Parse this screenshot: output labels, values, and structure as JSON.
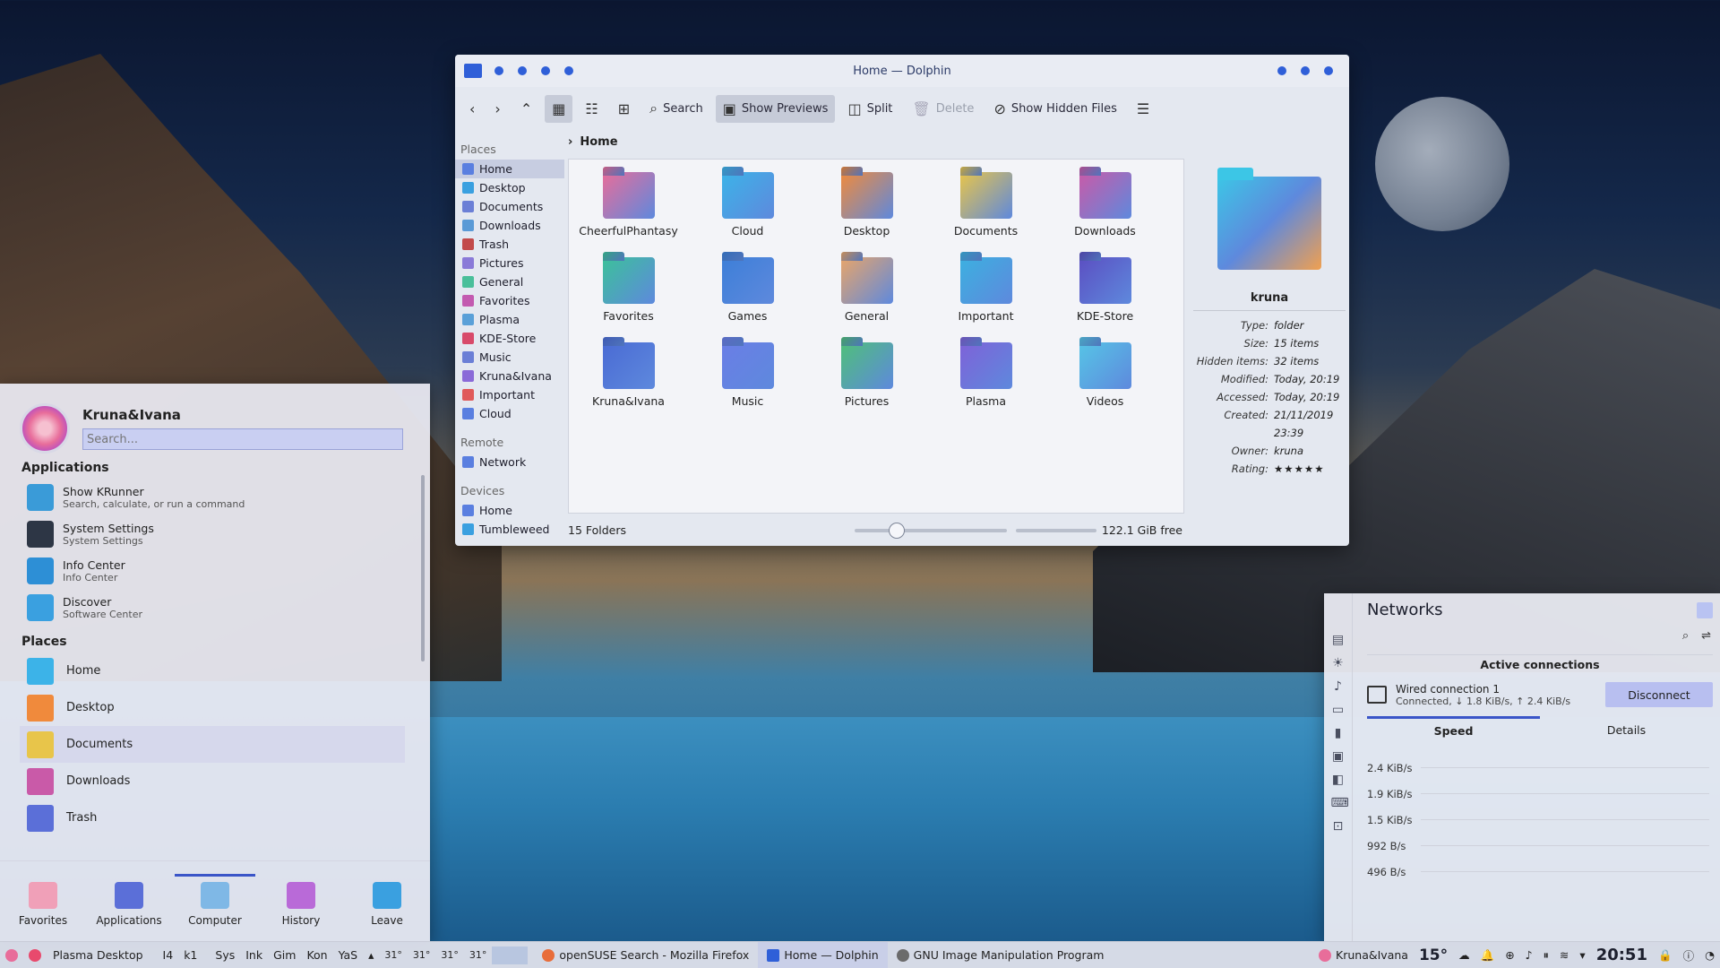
{
  "dolphin": {
    "title": "Home — Dolphin",
    "toolbar": {
      "search": "Search",
      "show_previews": "Show Previews",
      "split": "Split",
      "delete": "Delete",
      "show_hidden": "Show Hidden Files"
    },
    "breadcrumb": "Home",
    "places_header": "Places",
    "places": [
      "Home",
      "Desktop",
      "Documents",
      "Downloads",
      "Trash",
      "Pictures",
      "General",
      "Favorites",
      "Plasma",
      "KDE-Store",
      "Music",
      "Kruna&Ivana",
      "Important",
      "Cloud"
    ],
    "remote_header": "Remote",
    "remote": [
      "Network"
    ],
    "devices_header": "Devices",
    "devices": [
      "Home",
      "Tumbleweed"
    ],
    "folders": [
      {
        "name": "CheerfulPhantasy",
        "color": "#e86d9a"
      },
      {
        "name": "Cloud",
        "color": "#3cb3e8"
      },
      {
        "name": "Desktop",
        "color": "#f08a3c"
      },
      {
        "name": "Documents",
        "color": "#e8c54a"
      },
      {
        "name": "Downloads",
        "color": "#c95aa8"
      },
      {
        "name": "Favorites",
        "color": "#3cc19a"
      },
      {
        "name": "Games",
        "color": "#3d7fd8"
      },
      {
        "name": "General",
        "color": "#e8a56a"
      },
      {
        "name": "Important",
        "color": "#3cb0e0"
      },
      {
        "name": "KDE-Store",
        "color": "#5b4fc2"
      },
      {
        "name": "Kruna&Ivana",
        "color": "#4a6bd4"
      },
      {
        "name": "Music",
        "color": "#6a7ee6"
      },
      {
        "name": "Pictures",
        "color": "#4fbf7a"
      },
      {
        "name": "Plasma",
        "color": "#7e62d8"
      },
      {
        "name": "Videos",
        "color": "#56c4e6"
      }
    ],
    "status": "15 Folders",
    "free_space": "122.1 GiB free",
    "info": {
      "name": "kruna",
      "rows": [
        {
          "k": "Type:",
          "v": "folder"
        },
        {
          "k": "Size:",
          "v": "15 items"
        },
        {
          "k": "Hidden items:",
          "v": "32 items"
        },
        {
          "k": "Modified:",
          "v": "Today, 20:19"
        },
        {
          "k": "Accessed:",
          "v": "Today, 20:19"
        },
        {
          "k": "Created:",
          "v": "21/11/2019 23:39"
        },
        {
          "k": "Owner:",
          "v": "kruna"
        }
      ],
      "rating_label": "Rating:",
      "rating_stars": "★★★★★"
    }
  },
  "launcher": {
    "user": "Kruna&Ivana",
    "search_placeholder": "Search...",
    "applications_header": "Applications",
    "apps": [
      {
        "name": "Show KRunner",
        "desc": "Search, calculate, or run a command",
        "color": "#3a9bd8"
      },
      {
        "name": "System Settings",
        "desc": "System Settings",
        "color": "#2d3645"
      },
      {
        "name": "Info Center",
        "desc": "Info Center",
        "color": "#2d8fd6"
      },
      {
        "name": "Discover",
        "desc": "Software Center",
        "color": "#3aa0e0"
      }
    ],
    "places_header": "Places",
    "places": [
      {
        "name": "Home",
        "color": "#3cb3e8"
      },
      {
        "name": "Desktop",
        "color": "#f08a3c"
      },
      {
        "name": "Documents",
        "color": "#e8c54a"
      },
      {
        "name": "Downloads",
        "color": "#c95aa8"
      },
      {
        "name": "Trash",
        "color": "#5b6fd8"
      }
    ],
    "tabs": [
      "Favorites",
      "Applications",
      "Computer",
      "History",
      "Leave"
    ]
  },
  "networks": {
    "title": "Networks",
    "active_connections": "Active connections",
    "connection_name": "Wired connection 1",
    "connection_status": "Connected, ↓ 1.8 KiB/s, ↑ 2.4 KiB/s",
    "disconnect": "Disconnect",
    "tab_speed": "Speed",
    "tab_details": "Details",
    "speed_labels": [
      "2.4 KiB/s",
      "1.9 KiB/s",
      "1.5 KiB/s",
      "992 B/s",
      "496 B/s"
    ]
  },
  "taskbar": {
    "activity": "Plasma Desktop",
    "desktops": [
      "I4",
      "k1"
    ],
    "quicklaunch": [
      "Sys",
      "Ink",
      "Gim",
      "Kon",
      "YaS"
    ],
    "temps": [
      "31°",
      "31°",
      "31°",
      "31°"
    ],
    "tasks": [
      {
        "label": "openSUSE Search - Mozilla Firefox",
        "active": false
      },
      {
        "label": "Home — Dolphin",
        "active": true
      },
      {
        "label": "GNU Image Manipulation Program",
        "active": false
      }
    ],
    "user": "Kruna&Ivana",
    "weather": "15°",
    "clock": "20:51"
  }
}
